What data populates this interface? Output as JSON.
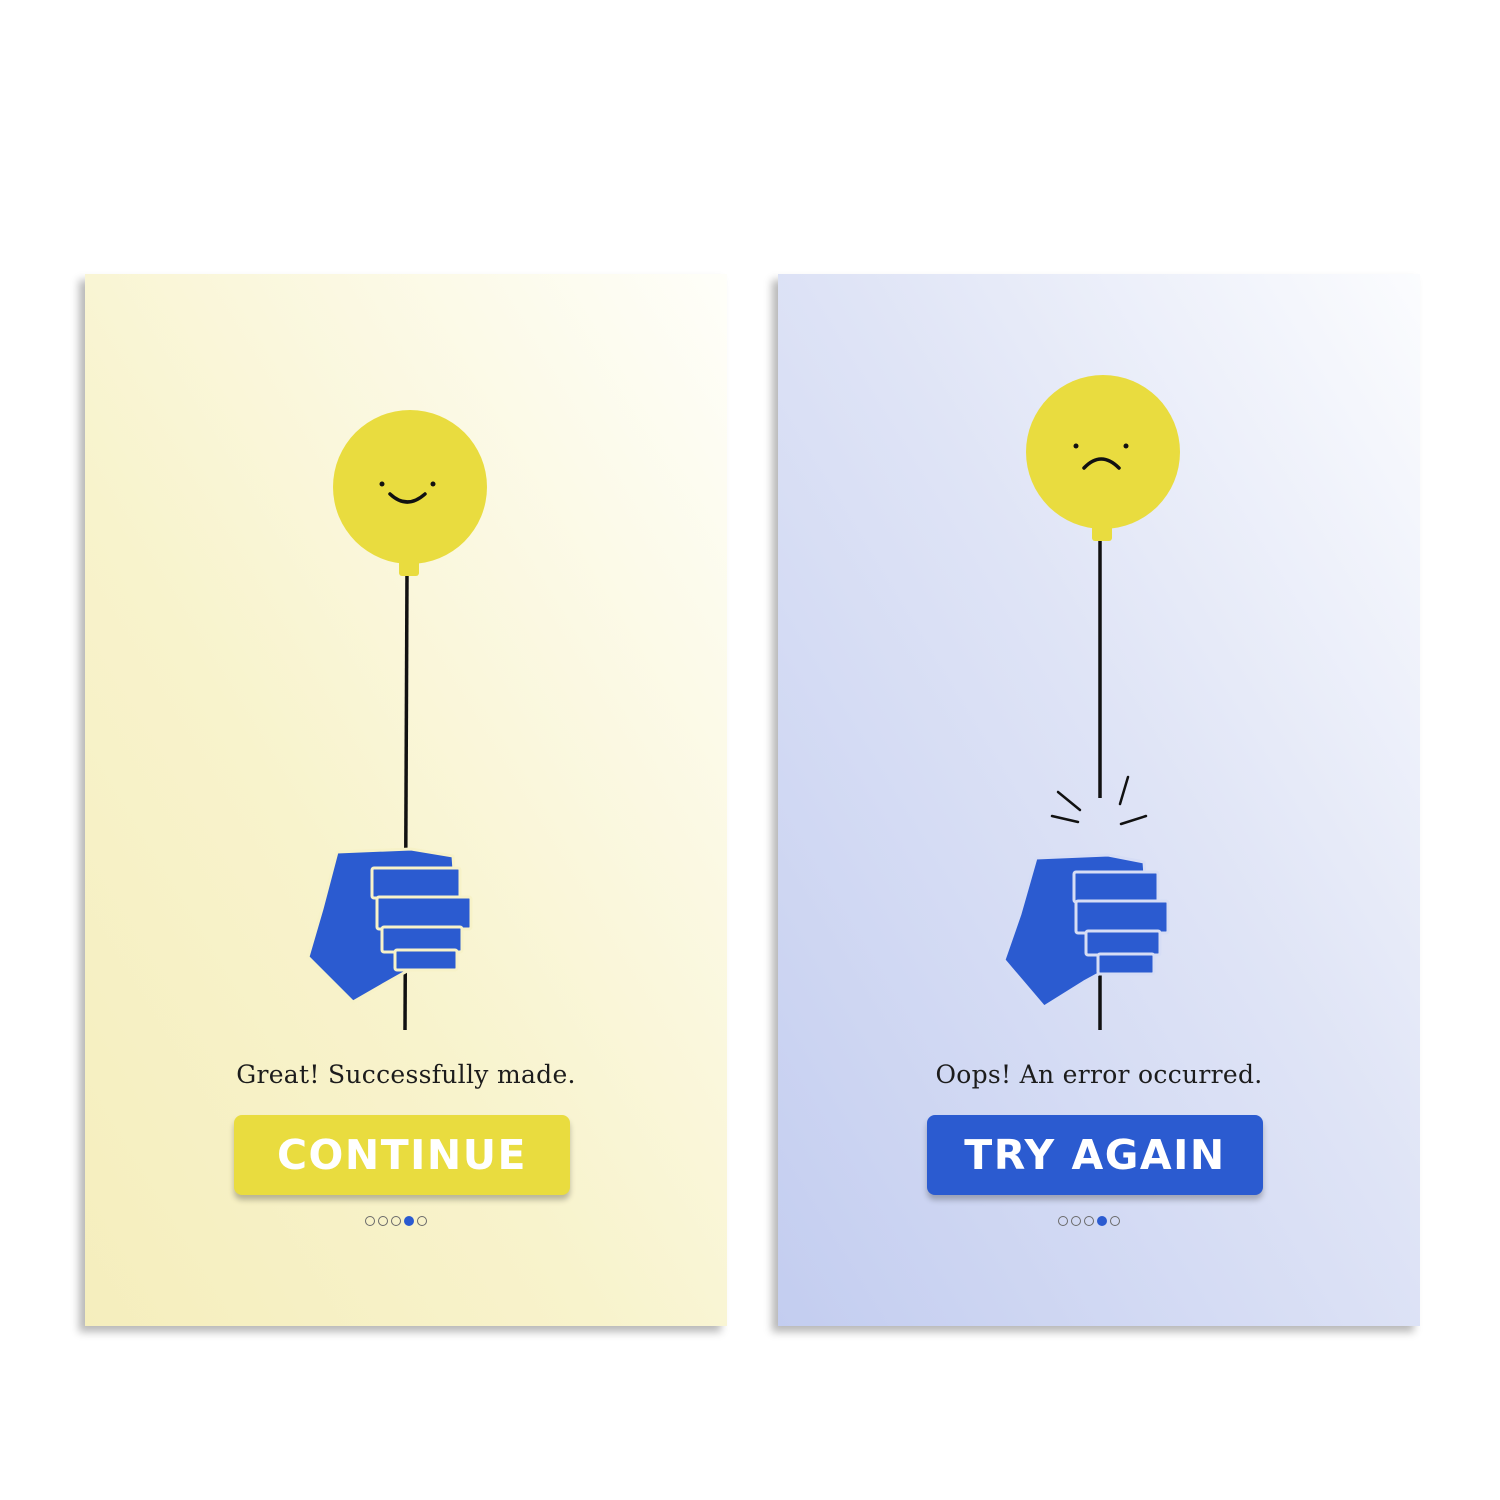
{
  "colors": {
    "balloon": "#e9dc3f",
    "hand": "#2b5bd0",
    "success_button": "#e9dc3f",
    "error_button": "#2b5bd0",
    "active_dot": "#2b5bd0"
  },
  "success_screen": {
    "message": "Great! Successfully made.",
    "button_label": "CONTINUE",
    "balloon_mood": "smile-face-icon",
    "pagination": {
      "total": 5,
      "active_index": 3
    }
  },
  "error_screen": {
    "message": "Oops! An error occurred.",
    "button_label": "TRY AGAIN",
    "balloon_mood": "frown-face-icon",
    "pagination": {
      "total": 5,
      "active_index": 3
    }
  }
}
